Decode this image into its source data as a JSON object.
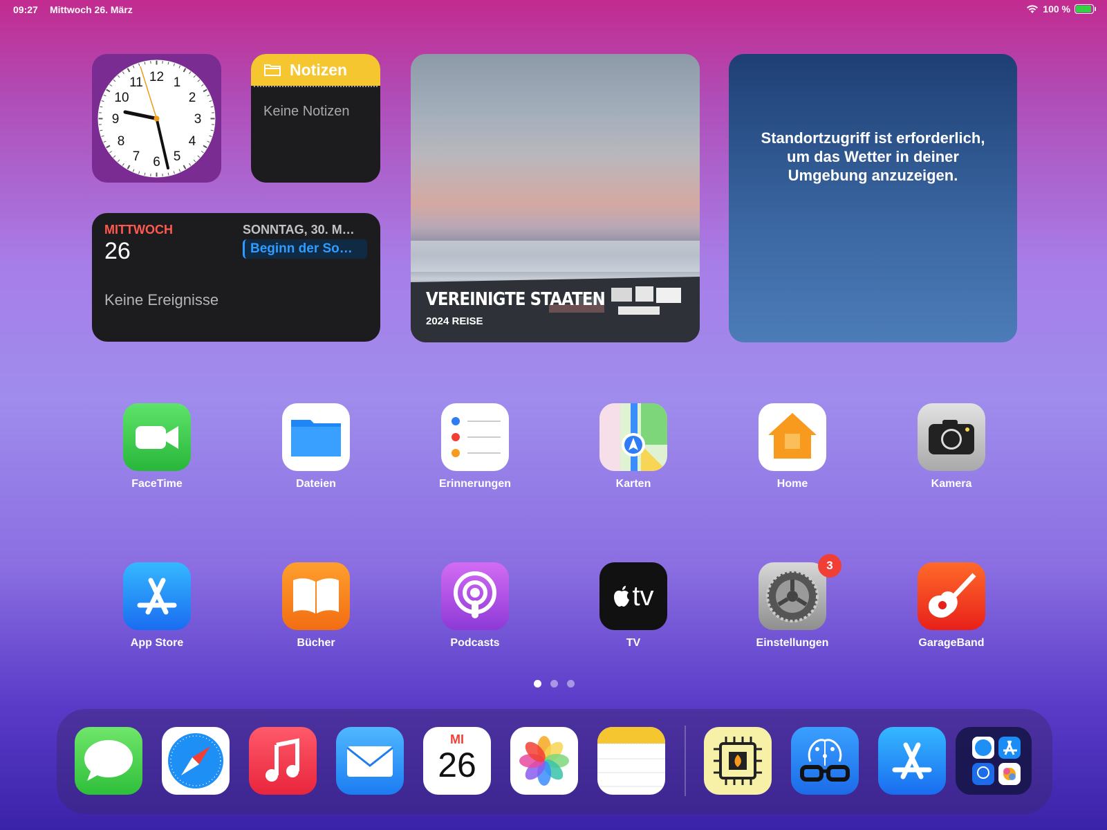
{
  "status_bar": {
    "time": "09:27",
    "date": "Mittwoch 26. März",
    "battery": "100 %",
    "battery_level": 1.0
  },
  "widgets": {
    "notes": {
      "title": "Notizen",
      "empty": "Keine Notizen"
    },
    "calendar": {
      "weekday": "MITTWOCH",
      "day": "26",
      "empty": "Keine Ereignisse",
      "next_date": "SONNTAG, 30. M…",
      "next_event": "Beginn der So…"
    },
    "photo": {
      "title": "VEREINIGTE STAATEN",
      "subtitle": "2024 REISE"
    },
    "weather": {
      "message": "Standortzugriff ist erforderlich, um das Wetter in deiner Umgebung anzuzeigen."
    }
  },
  "apps": [
    {
      "label": "FaceTime",
      "icon": "facetime-icon"
    },
    {
      "label": "Dateien",
      "icon": "files-icon"
    },
    {
      "label": "Erinnerungen",
      "icon": "reminders-icon"
    },
    {
      "label": "Karten",
      "icon": "maps-icon"
    },
    {
      "label": "Home",
      "icon": "home-icon"
    },
    {
      "label": "Kamera",
      "icon": "camera-icon"
    },
    {
      "label": "App Store",
      "icon": "appstore-icon"
    },
    {
      "label": "Bücher",
      "icon": "books-icon"
    },
    {
      "label": "Podcasts",
      "icon": "podcasts-icon"
    },
    {
      "label": "TV",
      "icon": "tv-icon",
      "icon_text": "tv"
    },
    {
      "label": "Einstellungen",
      "icon": "settings-icon",
      "badge": "3"
    },
    {
      "label": "GarageBand",
      "icon": "garageband-icon"
    }
  ],
  "page_dots": {
    "count": 3,
    "active": 0
  },
  "dock": {
    "items": [
      "messages-icon",
      "safari-icon",
      "music-icon",
      "mail-icon",
      "calendar-icon",
      "photos-icon",
      "notes-icon",
      "cpu-app-icon",
      "ai-brain-app-icon",
      "appstore-icon",
      "app-library-icon"
    ],
    "calendar_month": "MI",
    "calendar_day": "26"
  },
  "colors": {
    "badge": "#f23f36",
    "calendar_red": "#ff5a4f",
    "event_blue": "#2f9cff"
  }
}
